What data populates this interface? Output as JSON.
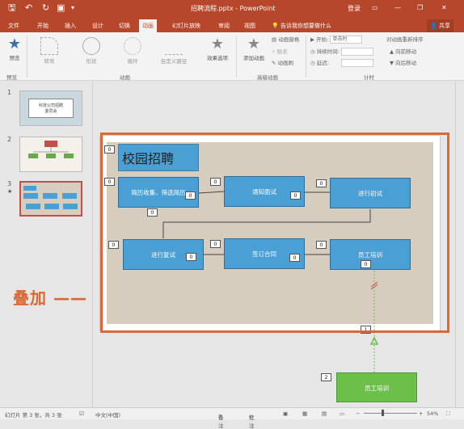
{
  "titlebar": {
    "save_icon": "save-icon",
    "undo_icon": "undo-icon",
    "redo_icon": "redo-icon",
    "present_icon": "present-icon",
    "customize_icon": "chevron-down-icon",
    "title": "招聘流程.pptx - PowerPoint",
    "login": "登录",
    "ribbon_toggle": "ribbon-display-icon",
    "min": "—",
    "restore": "❐",
    "close": "✕"
  },
  "tabs": [
    {
      "label": "文件"
    },
    {
      "label": "开始"
    },
    {
      "label": "插入"
    },
    {
      "label": "设计"
    },
    {
      "label": "切换"
    },
    {
      "label": "动画"
    },
    {
      "label": "幻灯片放映"
    },
    {
      "label": "审阅"
    },
    {
      "label": "视图"
    }
  ],
  "tellme": "告诉我你想要做什么",
  "share": "共享",
  "ribbon": {
    "preview": {
      "label": "预览",
      "group": "预览"
    },
    "animations": [
      {
        "label": "转弯"
      },
      {
        "label": "形状"
      },
      {
        "label": "循环"
      },
      {
        "label": "自定义路径"
      }
    ],
    "animation_group": "动画",
    "effect_options": "效果选项",
    "add_animation": "添加动画",
    "animation_pane": "动画窗格",
    "trigger": "触发",
    "painter": "动画刷",
    "advanced_group": "高级动画",
    "start_label": "开始:",
    "start_value": "单击时",
    "duration_label": "持续时间:",
    "delay_label": "延迟:",
    "reorder_title": "对动画重新排序",
    "move_earlier": "向前移动",
    "move_later": "向后移动",
    "timing_group": "计时"
  },
  "thumbnails": [
    {
      "num": "1",
      "text": "科技公司招聘\n委员会"
    },
    {
      "num": "2",
      "text": ""
    },
    {
      "num": "3",
      "star": "★",
      "text": ""
    }
  ],
  "slide": {
    "title": "校园招聘",
    "boxes": [
      {
        "text": "简历收集、筛选简历"
      },
      {
        "text": "通知面试"
      },
      {
        "text": "进行初试"
      },
      {
        "text": "进行复试"
      },
      {
        "text": "签订合同"
      },
      {
        "text": "员工培训"
      }
    ],
    "tags": [
      "0",
      "0",
      "0",
      "0",
      "0",
      "0",
      "0",
      "0",
      "0",
      "0",
      "0",
      "0",
      "0",
      "1"
    ]
  },
  "offslide": {
    "tag": "2",
    "box_text": "员工培训"
  },
  "overlay_label": "叠加",
  "status": {
    "slide_info": "幻灯片 第 3 张，共 3 张",
    "language": "中文(中国)",
    "notes": "备注",
    "comments": "批注",
    "zoom": "54%"
  }
}
